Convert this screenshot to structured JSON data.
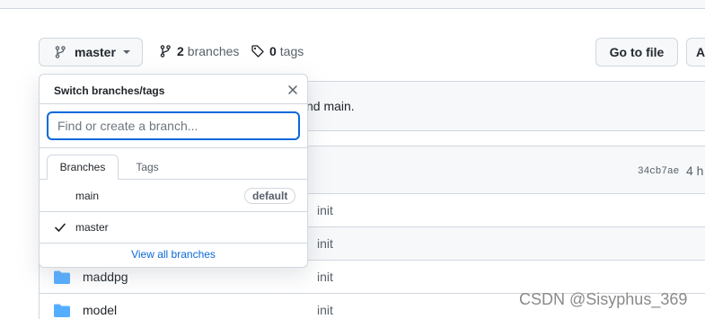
{
  "header": {
    "branch_button_label": "master",
    "branches_count": "2",
    "branches_label": "branches",
    "tags_count": "0",
    "tags_label": "tags",
    "go_to_file_label": "Go to file",
    "cut_button_label": "A"
  },
  "notice": {
    "text": "nd main."
  },
  "latest_commit": {
    "hash": "34cb7ae",
    "time": "4 h"
  },
  "files": [
    {
      "name": "",
      "message": "init"
    },
    {
      "name": "",
      "message": "init"
    },
    {
      "name": "maddpg",
      "message": "init"
    },
    {
      "name": "model",
      "message": "init"
    }
  ],
  "branch_dropdown": {
    "title": "Switch branches/tags",
    "search_placeholder": "Find or create a branch...",
    "tabs": [
      {
        "label": "Branches",
        "active": true
      },
      {
        "label": "Tags",
        "active": false
      }
    ],
    "branches": [
      {
        "name": "main",
        "badge": "default",
        "selected": false
      },
      {
        "name": "master",
        "badge": "",
        "selected": true
      }
    ],
    "view_all_label": "View all branches"
  },
  "watermark": "CSDN @Sisyphus_369",
  "colors": {
    "accent": "#0969da",
    "folder": "#54aeff",
    "border": "#d0d7de",
    "muted": "#57606a"
  }
}
